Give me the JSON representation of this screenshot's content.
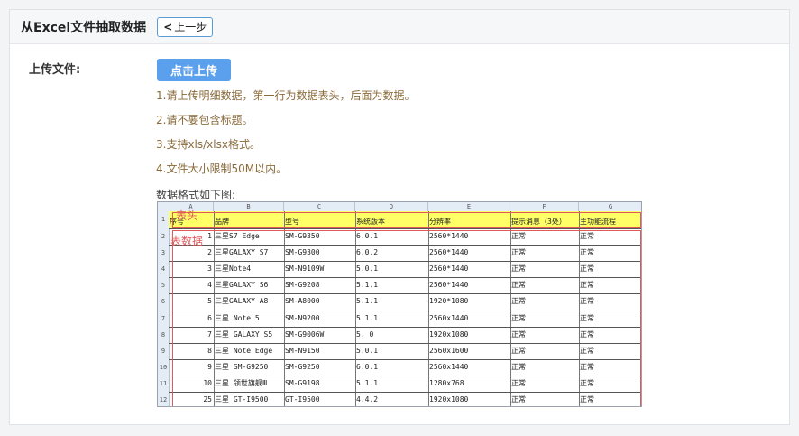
{
  "header": {
    "title": "从Excel文件抽取数据",
    "back_label": "上一步",
    "back_icon": "chevron-left-icon"
  },
  "upload": {
    "label": "上传文件:",
    "button_label": "点击上传"
  },
  "notes": [
    "1.请上传明细数据，第一行为数据表头，后面为数据。",
    "2.请不要包含标题。",
    "3.支持xls/xlsx格式。",
    "4.文件大小限制50M以内。"
  ],
  "format_label": "数据格式如下图:",
  "sheet": {
    "column_letters": [
      "A",
      "B",
      "C",
      "D",
      "E",
      "F",
      "G"
    ],
    "headers": [
      "序号",
      "品牌",
      "型号",
      "系统版本",
      "分辨率",
      "提示消息（3处）",
      "主功能流程"
    ],
    "annotation_header": "表头",
    "annotation_data": "表数据",
    "row_numbers": [
      "1",
      "2",
      "3",
      "4",
      "5",
      "6",
      "7",
      "8",
      "9",
      "10",
      "11",
      "12"
    ],
    "rows": [
      [
        "1",
        "三星S7 Edge",
        "SM-G9350",
        "6.0.1",
        "2560*1440",
        "正常",
        "正常"
      ],
      [
        "2",
        "三星GALAXY S7",
        "SM-G9300",
        "6.0.2",
        "2560*1440",
        "正常",
        "正常"
      ],
      [
        "3",
        "三星Note4",
        "SM-N9109W",
        "5.0.1",
        "2560*1440",
        "正常",
        "正常"
      ],
      [
        "4",
        "三星GALAXY S6",
        "SM-G9208",
        "5.1.1",
        "2560*1440",
        "正常",
        "正常"
      ],
      [
        "5",
        "三星GALAXY A8",
        "SM-A8000",
        "5.1.1",
        "1920*1080",
        "正常",
        "正常"
      ],
      [
        "6",
        "三星 Note 5",
        "SM-N9200",
        "5.1.1",
        "2560x1440",
        "正常",
        "正常"
      ],
      [
        "7",
        "三星 GALAXY S5",
        "SM-G9006W",
        "5. 0",
        "1920x1080",
        "正常",
        "正常"
      ],
      [
        "8",
        "三星 Note Edge",
        "SM-N9150",
        "5.0.1",
        "2560x1600",
        "正常",
        "正常"
      ],
      [
        "9",
        "三星 SM-G9250",
        "SM-G9250",
        "6.0.1",
        "2560x1440",
        "正常",
        "正常"
      ],
      [
        "10",
        "三星 领世旗舰Ⅲ",
        "SM-G9198",
        "5.1.1",
        "1280x768",
        "正常",
        "正常"
      ],
      [
        "25",
        "三星 GT-I9500",
        "GT-I9500",
        "4.4.2",
        "1920x1080",
        "正常",
        "正常"
      ]
    ]
  }
}
